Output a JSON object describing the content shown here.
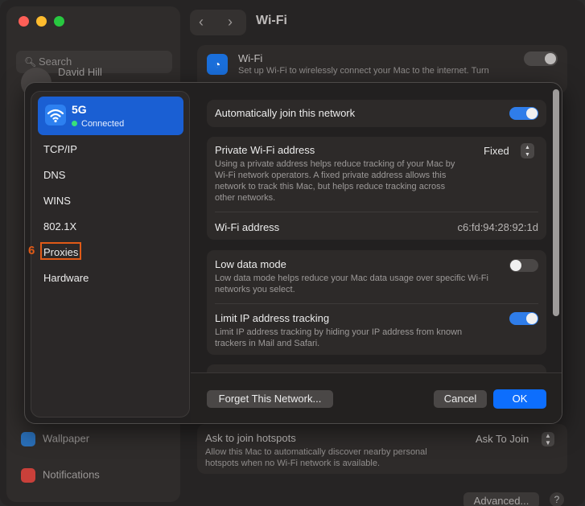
{
  "background": {
    "window_title": "Wi-Fi",
    "search_placeholder": "Search",
    "user_name": "David Hill",
    "sidebar_items": [
      {
        "label": "Wallpaper",
        "icon": "wallpaper-icon"
      },
      {
        "label": "Notifications",
        "icon": "bell-icon"
      }
    ],
    "wifi_card": {
      "title": "Wi-Fi",
      "description": "Set up Wi-Fi to wirelessly connect your Mac to the internet. Turn"
    },
    "hotspots": {
      "title": "Ask to join hotspots",
      "description": "Allow this Mac to automatically discover nearby personal hotspots when no Wi-Fi network is available.",
      "value": "Ask To Join"
    },
    "advanced_label": "Advanced...",
    "help_label": "?"
  },
  "dialog": {
    "network": {
      "name": "5G",
      "status": "Connected",
      "icon": "wifi-icon"
    },
    "sidebar": [
      {
        "label": "TCP/IP"
      },
      {
        "label": "DNS"
      },
      {
        "label": "WINS"
      },
      {
        "label": "802.1X"
      },
      {
        "label": "Proxies"
      },
      {
        "label": "Hardware"
      }
    ],
    "annotation_step": "6",
    "auto_join": {
      "label": "Automatically join this network",
      "on": true
    },
    "private_address": {
      "label": "Private Wi-Fi address",
      "description": "Using a private address helps reduce tracking of your Mac by Wi-Fi network operators. A fixed private address allows this network to track this Mac, but helps reduce tracking across other networks.",
      "value": "Fixed"
    },
    "wifi_address": {
      "label": "Wi-Fi address",
      "value": "c6:fd:94:28:92:1d"
    },
    "low_data": {
      "label": "Low data mode",
      "description": "Low data mode helps reduce your Mac data usage over specific Wi-Fi networks you select.",
      "on": false
    },
    "limit_ip": {
      "label": "Limit IP address tracking",
      "description": "Limit IP address tracking by hiding your IP address from known trackers in Mail and Safari.",
      "on": true
    },
    "forget_button": "Forget This Network...",
    "cancel_button": "Cancel",
    "ok_button": "OK"
  }
}
